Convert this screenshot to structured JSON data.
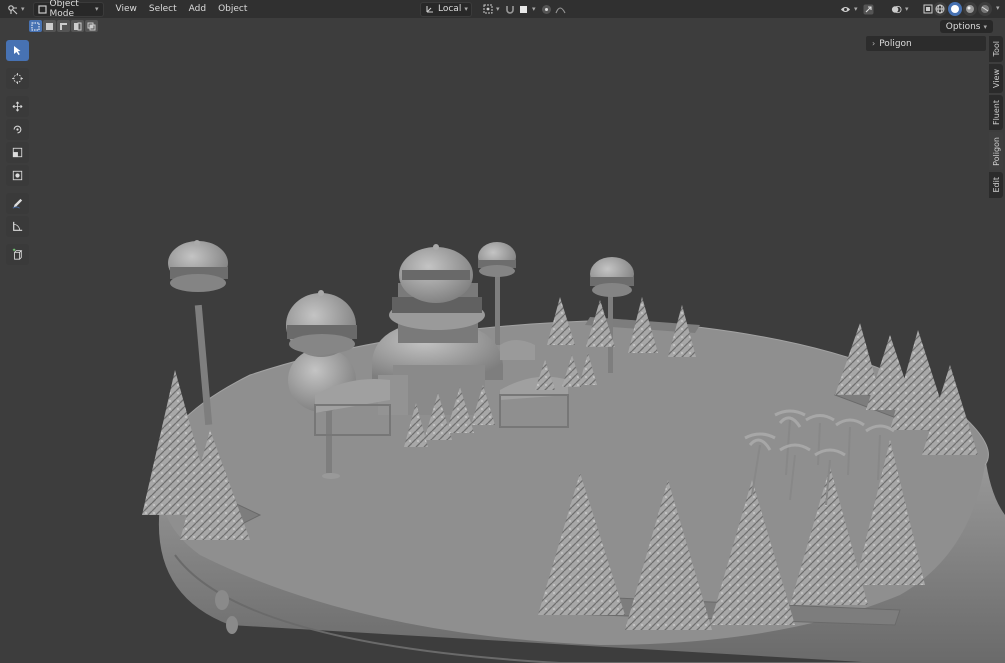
{
  "header": {
    "mode_label": "Object Mode",
    "menus": [
      "View",
      "Select",
      "Add",
      "Object"
    ],
    "transform_orientation": "Local"
  },
  "subheader": {
    "options_label": "Options"
  },
  "npanel": {
    "panel_title": "Poligon",
    "tabs": [
      "Tool",
      "View",
      "Fluent",
      "Poligon",
      "Edit"
    ],
    "active_tab": "Poligon"
  },
  "colors": {
    "accent": "#4772b3",
    "header_bg": "#303030",
    "viewport_bg": "#3d3d3d",
    "model_gray": "#8f8f8f"
  },
  "toolbar": {
    "tools": [
      "select-box",
      "cursor",
      "move",
      "rotate",
      "scale",
      "transform",
      "annotate",
      "measure",
      "add-cube"
    ],
    "active_tool": "select-box"
  }
}
